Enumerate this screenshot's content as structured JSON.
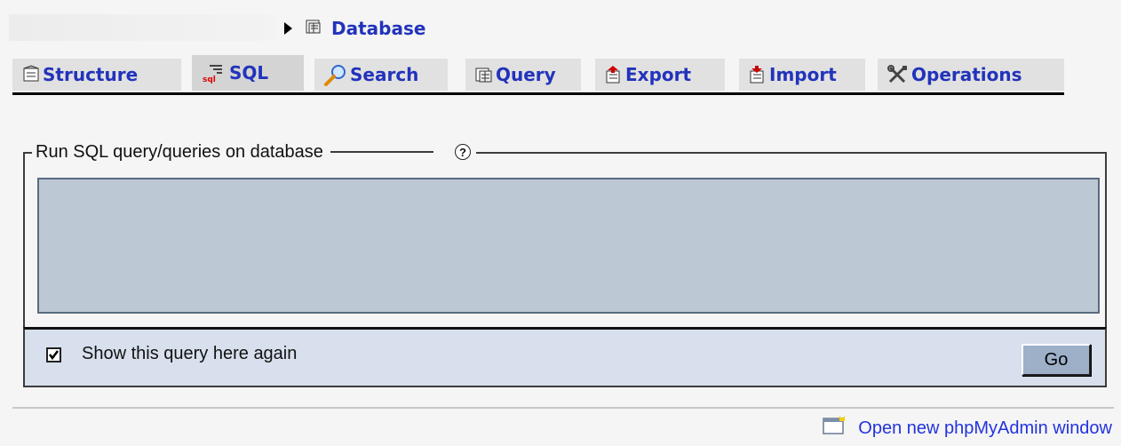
{
  "breadcrumb": {
    "label": "Database"
  },
  "tabs": [
    {
      "label": "Structure",
      "icon": "structure-icon"
    },
    {
      "label": "SQL",
      "icon": "sql-icon",
      "active": true
    },
    {
      "label": "Search",
      "icon": "search-icon"
    },
    {
      "label": "Query",
      "icon": "query-icon"
    },
    {
      "label": "Export",
      "icon": "export-icon"
    },
    {
      "label": "Import",
      "icon": "import-icon"
    },
    {
      "label": "Operations",
      "icon": "operations-icon"
    }
  ],
  "sql_panel": {
    "legend": "Run SQL query/queries on database",
    "help_icon": "?",
    "query_text": "",
    "show_again_label": "Show this query here again",
    "show_again_checked": true,
    "go_label": "Go"
  },
  "footer": {
    "new_window_label": "Open new phpMyAdmin window"
  },
  "colors": {
    "link": "#2233bb",
    "textarea_bg": "#bdc8d5",
    "footer_bg": "#d7e0ec",
    "button_bg": "#9db0c8"
  }
}
